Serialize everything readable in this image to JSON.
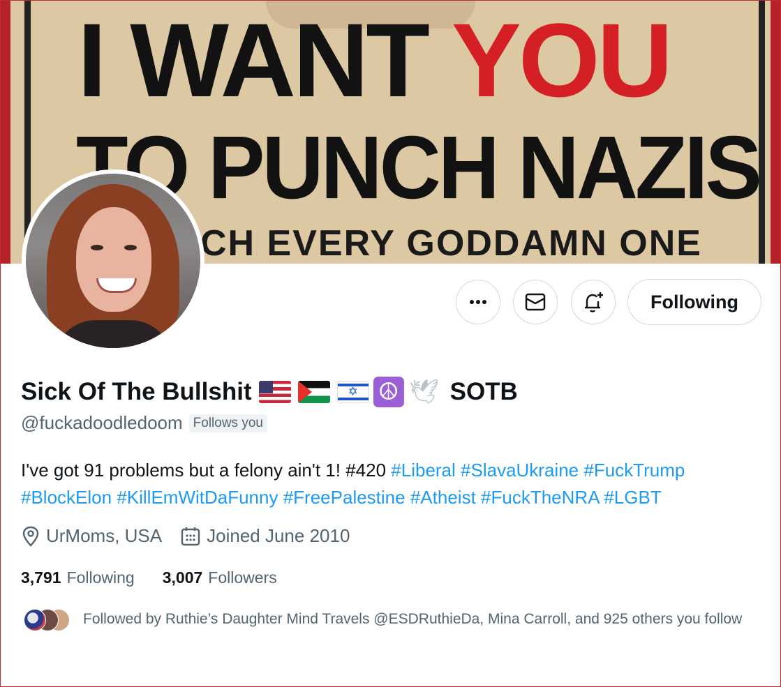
{
  "banner": {
    "line1_a": "I WANT",
    "line1_b": "YOU",
    "line2": "TO PUNCH NAZIS",
    "line3": "CH EVERY GODDAMN ONE"
  },
  "actions": {
    "more_icon": "more-horizontal-icon",
    "message_icon": "envelope-icon",
    "notify_icon": "bell-plus-icon",
    "following_label": "Following"
  },
  "profile": {
    "name": "Sick Of The Bullshit",
    "name_suffix": "SOTB",
    "flags": [
      "us-flag",
      "palestine-flag",
      "israel-flag",
      "peace-symbol",
      "dove"
    ],
    "peace_glyph": "☮",
    "dove_glyph": "🕊",
    "israel_star": "✡",
    "handle": "@fuckadoodledoom",
    "follows_you": "Follows you"
  },
  "bio": {
    "plain": "I've got 91 problems but a felony ain't 1! #420 ",
    "tags": [
      "#Liberal",
      "#SlavaUkraine",
      "#FuckTrump",
      "#BlockElon",
      "#KillEmWitDaFunny",
      "#FreePalestine",
      "#Atheist",
      "#FuckTheNRA",
      "#LGBT"
    ]
  },
  "meta": {
    "location": "UrMoms, USA",
    "joined": "Joined June 2010"
  },
  "stats": {
    "following_count": "3,791",
    "following_label": "Following",
    "followers_count": "3,007",
    "followers_label": "Followers"
  },
  "followed_by": {
    "text": "Followed by Ruthie’s Daughter Mind Travels @ESDRuthieDa, Mina Carroll, and 925 others you follow"
  },
  "colors": {
    "accent": "#1d9bf0",
    "secondary_text": "#536471",
    "primary_text": "#0f1419",
    "border": "#cfd9de"
  }
}
